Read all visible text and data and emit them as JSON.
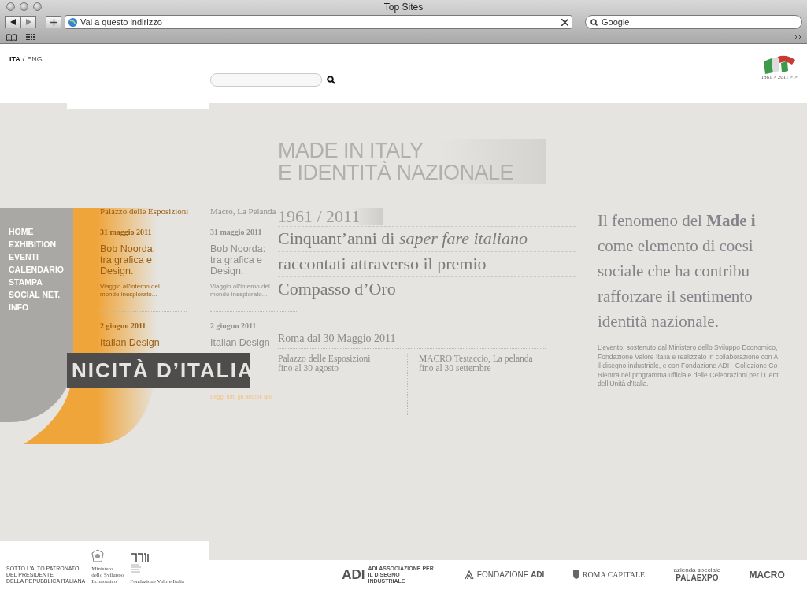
{
  "browser": {
    "title": "Top Sites",
    "address": {
      "placeholder": "Vai a questo indirizzo"
    },
    "search": {
      "placeholder": "Google"
    }
  },
  "header": {
    "languages": [
      {
        "label": "ITA",
        "selected": true
      },
      {
        "label": "ENG",
        "selected": false
      }
    ],
    "separator": "/",
    "logo_text": "1861 > 2011 > >"
  },
  "headline": [
    "MADE IN ITALY",
    "E IDENTITÀ NAZIONALE"
  ],
  "nav": [
    {
      "label": "HOME"
    },
    {
      "label": "EXHIBITION"
    },
    {
      "label": "EVENTI"
    },
    {
      "label": "CALENDARIO"
    },
    {
      "label": "STAMPA"
    },
    {
      "label": "SOCIAL NET."
    },
    {
      "label": "INFO"
    }
  ],
  "event_columns": [
    {
      "venue": "Palazzo delle Esposizioni",
      "on_orange": true,
      "events": [
        {
          "date": "31 maggio 2011",
          "title": "Bob Noorda: tra grafica e Design.",
          "summary": "Viaggio all'interno del mondo inesplorato..."
        },
        {
          "date": "2 giugno 2011",
          "title": "Italian Design"
        }
      ]
    },
    {
      "venue": "Macro, La Pelanda",
      "on_orange": false,
      "events": [
        {
          "date": "31 maggio 2011",
          "title": "Bob Noorda: tra grafica e Design.",
          "summary": "Viaggio all'interno del mondo inesplorato..."
        },
        {
          "date": "2 giugno 2011",
          "title": "Italian Design"
        }
      ]
    }
  ],
  "read_all": "Leggi tutti gli articoli qui",
  "banner": "NICITÀ D’ITALIA",
  "feature": {
    "years": "1961 / 2011",
    "lines": [
      "Cinquant’anni di *saper fare italiano*",
      "raccontati attraverso il premio",
      "Compasso d’Oro"
    ],
    "dates": "Roma dal 30 Maggio 2011",
    "venues": [
      {
        "name": "Palazzo delle Esposizioni",
        "until": "fino al 30 agosto"
      },
      {
        "name": "MACRO Testaccio, La pelanda",
        "until": "fino al 30 settembre"
      }
    ]
  },
  "intro": {
    "lines": [
      "Il fenomeno del **Made i**",
      "come elemento di coesi",
      "sociale che ha contribu",
      "rafforzare il sentimento",
      "identità nazionale."
    ],
    "notes": [
      "L’evento, sostenuto dal Ministero dello Sviluppo Economico,",
      "Fondazione Valore Italia e realizzato in collaborazione con A",
      "il disegno industriale, e con Fondazione ADI - Collezione Co",
      "Rientra nel programma ufficiale delle Celebrazioni per i Cent",
      "dell’Unità d’Italia."
    ]
  },
  "footer": {
    "patronage": [
      "SOTTO L’ALTO PATRONATO",
      "DEL PRESIDENTE",
      "DELLA REPUBBLICA ITALIANA"
    ],
    "ministry": [
      "Ministero",
      "dello Sviluppo",
      "Economico"
    ],
    "foundation": "Fondazione Valore Italia",
    "sponsors": [
      {
        "kind": "adi",
        "name": "ADI",
        "sub": "ADI ASSOCIAZIONE PER IL DISEGNO INDUSTRIALE"
      },
      {
        "kind": "fondazione",
        "name": "FONDAZIONE **ADI**"
      },
      {
        "kind": "roma",
        "name": "ROMA CAPITALE"
      },
      {
        "kind": "palaexpo",
        "sub": "azienda speciale",
        "name": "PALAEXPO"
      },
      {
        "kind": "macro",
        "name": "MACRO"
      }
    ]
  }
}
